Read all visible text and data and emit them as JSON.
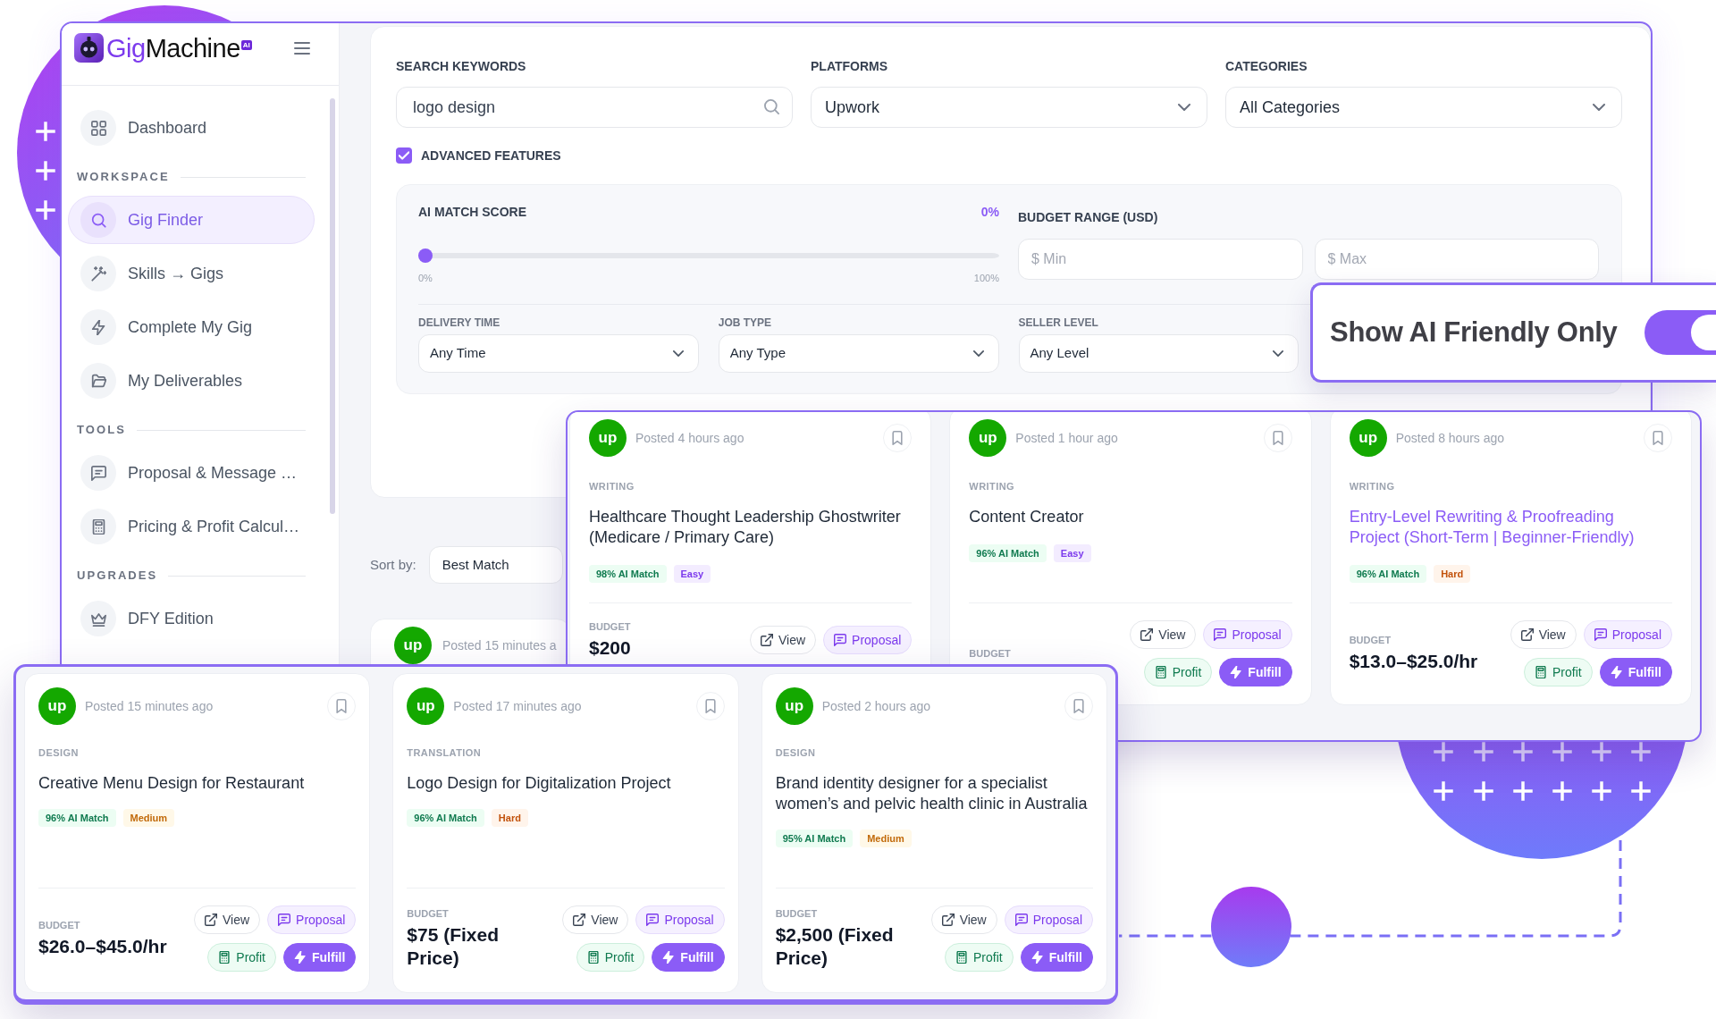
{
  "brand": {
    "accent": "Gig",
    "name": "Machine",
    "badge": "AI"
  },
  "sidebar": {
    "items": [
      {
        "label": "Dashboard",
        "selected": false
      }
    ],
    "sections": [
      {
        "title": "WORKSPACE",
        "items": [
          {
            "label": "Gig Finder",
            "selected": true
          },
          {
            "label": "Skills → Gigs",
            "selected": false
          },
          {
            "label": "Complete My Gig",
            "selected": false
          },
          {
            "label": "My Deliverables",
            "selected": false
          }
        ]
      },
      {
        "title": "TOOLS",
        "items": [
          {
            "label": "Proposal & Message …",
            "selected": false
          },
          {
            "label": "Pricing & Profit Calcul…",
            "selected": false
          }
        ]
      },
      {
        "title": "UPGRADES",
        "items": [
          {
            "label": "DFY Edition",
            "selected": false
          }
        ]
      }
    ]
  },
  "filters": {
    "search": {
      "label": "SEARCH KEYWORDS",
      "value": "logo design"
    },
    "platform": {
      "label": "PLATFORMS",
      "value": "Upwork"
    },
    "category": {
      "label": "CATEGORIES",
      "value": "All Categories"
    },
    "advanced": {
      "label": "ADVANCED FEATURES",
      "checked": true
    },
    "ai_match": {
      "label": "AI MATCH SCORE",
      "reading": "0%",
      "level": 0,
      "min_label": "0%",
      "max_label": "100%"
    },
    "budget": {
      "label": "BUDGET RANGE (USD)",
      "min": {
        "placeholder": "$ Min"
      },
      "max": {
        "placeholder": "$ Max"
      }
    },
    "selects": [
      {
        "label": "DELIVERY TIME",
        "value": "Any Time"
      },
      {
        "label": "JOB TYPE",
        "value": "Any Type"
      },
      {
        "label": "SELLER LEVEL",
        "value": "Any Level"
      }
    ]
  },
  "ai_friendly": {
    "label": "Show AI Friendly Only",
    "on": true
  },
  "sort": {
    "label": "Sort by:",
    "value": "Best Match"
  },
  "results_peek": {
    "avatar": "up",
    "posted": "Posted 15 minutes a"
  },
  "featured_top": [
    {
      "avatar": "up",
      "posted": "Posted 4 hours ago",
      "category": "WRITING",
      "title": "Healthcare Thought Leadership Ghostwriter (Medicare / Primary Care)",
      "highlighted": false,
      "tags": [
        {
          "label": "98% AI Match",
          "kind": "match"
        },
        {
          "label": "Easy",
          "kind": "easy"
        }
      ],
      "budget_label": "BUDGET",
      "budget": "$200",
      "actions": [
        {
          "label": "View",
          "kind": "view"
        },
        {
          "label": "Proposal",
          "kind": "proposal"
        }
      ]
    },
    {
      "avatar": "up",
      "posted": "Posted 1 hour ago",
      "category": "WRITING",
      "title": "Content Creator",
      "highlighted": false,
      "tags": [
        {
          "label": "96% AI Match",
          "kind": "match"
        },
        {
          "label": "Easy",
          "kind": "easy"
        }
      ],
      "budget_label": "BUDGET",
      "actions": [
        {
          "label": "View",
          "kind": "view"
        },
        {
          "label": "Proposal",
          "kind": "proposal"
        },
        {
          "label": "Profit",
          "kind": "profit"
        },
        {
          "label": "Fulfill",
          "kind": "fulfill"
        }
      ]
    },
    {
      "avatar": "up",
      "posted": "Posted 8 hours ago",
      "category": "WRITING",
      "title": "Entry-Level Rewriting & Proofreading Project (Short-Term | Beginner-Friendly)",
      "highlighted": true,
      "tags": [
        {
          "label": "96% AI Match",
          "kind": "match"
        },
        {
          "label": "Hard",
          "kind": "hard"
        }
      ],
      "budget_label": "BUDGET",
      "budget": "$13.0–$25.0/hr",
      "actions": [
        {
          "label": "View",
          "kind": "view"
        },
        {
          "label": "Proposal",
          "kind": "proposal"
        },
        {
          "label": "Profit",
          "kind": "profit"
        },
        {
          "label": "Fulfill",
          "kind": "fulfill"
        }
      ]
    }
  ],
  "featured_bottom": [
    {
      "avatar": "up",
      "posted": "Posted 15 minutes ago",
      "category": "DESIGN",
      "title": "Creative Menu Design for Restaurant",
      "highlighted": false,
      "tags": [
        {
          "label": "96% AI Match",
          "kind": "match"
        },
        {
          "label": "Medium",
          "kind": "medium"
        }
      ],
      "budget_label": "BUDGET",
      "budget": "$26.0–$45.0/hr",
      "actions": [
        {
          "label": "View",
          "kind": "view"
        },
        {
          "label": "Proposal",
          "kind": "proposal"
        },
        {
          "label": "Profit",
          "kind": "profit"
        },
        {
          "label": "Fulfill",
          "kind": "fulfill"
        }
      ]
    },
    {
      "avatar": "up",
      "posted": "Posted 17 minutes ago",
      "category": "TRANSLATION",
      "title": "Logo Design for Digitalization Project",
      "highlighted": false,
      "tags": [
        {
          "label": "96% AI Match",
          "kind": "match"
        },
        {
          "label": "Hard",
          "kind": "hard"
        }
      ],
      "budget_label": "BUDGET",
      "budget": "$75 (Fixed Price)",
      "actions": [
        {
          "label": "View",
          "kind": "view"
        },
        {
          "label": "Proposal",
          "kind": "proposal"
        },
        {
          "label": "Profit",
          "kind": "profit"
        },
        {
          "label": "Fulfill",
          "kind": "fulfill"
        }
      ]
    },
    {
      "avatar": "up",
      "posted": "Posted 2 hours ago",
      "category": "DESIGN",
      "title": "Brand identity designer for a specialist women’s and pelvic health clinic in Australia",
      "highlighted": false,
      "tags": [
        {
          "label": "95% AI Match",
          "kind": "match"
        },
        {
          "label": "Medium",
          "kind": "medium"
        }
      ],
      "budget_label": "BUDGET",
      "budget": "$2,500 (Fixed Price)",
      "actions": [
        {
          "label": "View",
          "kind": "view"
        },
        {
          "label": "Proposal",
          "kind": "proposal"
        },
        {
          "label": "Profit",
          "kind": "profit"
        },
        {
          "label": "Fulfill",
          "kind": "fulfill"
        }
      ]
    }
  ]
}
